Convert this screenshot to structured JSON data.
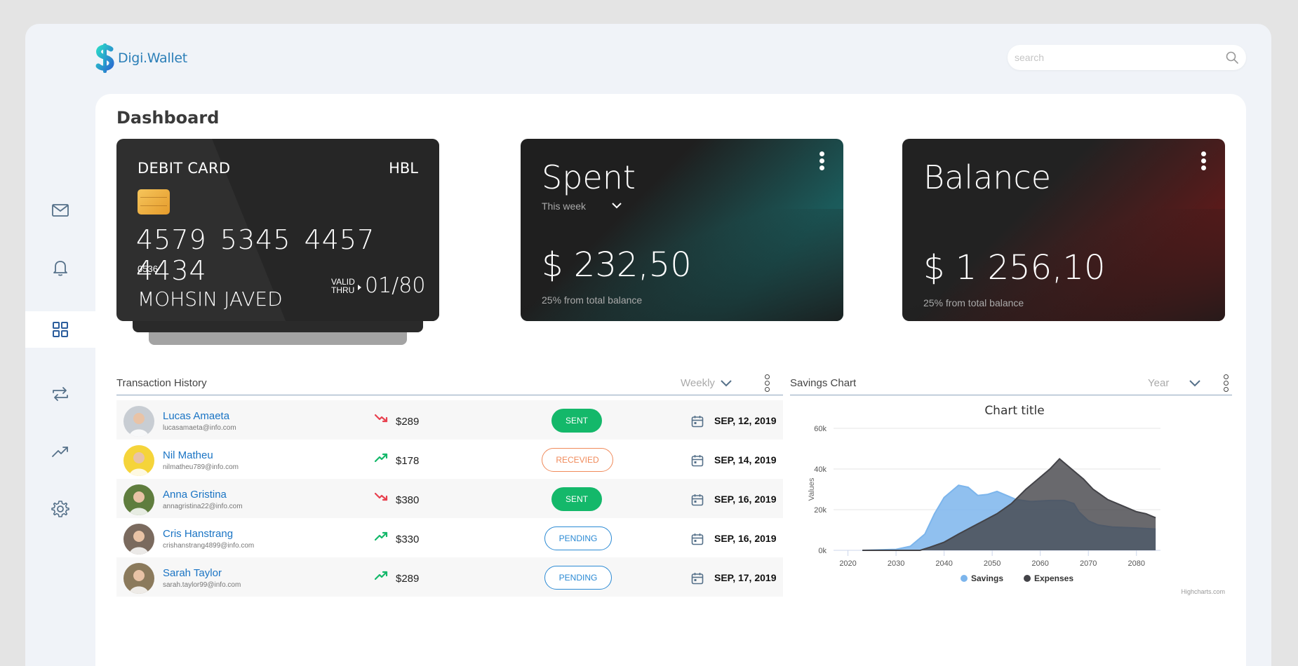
{
  "app": {
    "name": "Digi.Wallet"
  },
  "search": {
    "placeholder": "search"
  },
  "sidebar": {
    "items": [
      {
        "icon": "mail-icon",
        "active": false
      },
      {
        "icon": "bell-icon",
        "active": false
      },
      {
        "icon": "grid-icon",
        "active": true
      },
      {
        "icon": "transfer-icon",
        "active": false
      },
      {
        "icon": "trend-icon",
        "active": false
      },
      {
        "icon": "gear-icon",
        "active": false
      }
    ]
  },
  "page": {
    "title": "Dashboard"
  },
  "debit_card": {
    "label": "DEBIT CARD",
    "bank": "HBL",
    "number": "4579 5345 4457 4434",
    "code": "0536",
    "holder": "MOHSIN JAVED",
    "valid_label_1": "VALID",
    "valid_label_2": "THRU",
    "expiry": "01/80"
  },
  "spent": {
    "title": "Spent",
    "period": "This week",
    "amount": "$ 232,50",
    "note": "25% from total balance"
  },
  "balance": {
    "title": "Balance",
    "amount": "$ 1 256,10",
    "note": "25% from total balance"
  },
  "transactions": {
    "title": "Transaction History",
    "filter": "Weekly",
    "rows": [
      {
        "name": "Lucas Amaeta",
        "email": "lucasamaeta@info.com",
        "trend": "down",
        "amount": "$289",
        "status": "SENT",
        "status_type": "sent",
        "date": "SEP, 12, 2019",
        "avatar_color": "#c8cdd3"
      },
      {
        "name": "Nil Matheu",
        "email": "nilmatheu789@info.com",
        "trend": "up",
        "amount": "$178",
        "status": "RECEVIED",
        "status_type": "received",
        "date": "SEP, 14, 2019",
        "avatar_color": "#f5d43a"
      },
      {
        "name": "Anna Gristina",
        "email": "annagristina22@info.com",
        "trend": "down",
        "amount": "$380",
        "status": "SENT",
        "status_type": "sent",
        "date": "SEP, 16, 2019",
        "avatar_color": "#5f7d3e"
      },
      {
        "name": "Cris Hanstrang",
        "email": "crishanstrang4899@info.com",
        "trend": "up",
        "amount": "$330",
        "status": "PENDING",
        "status_type": "pending",
        "date": "SEP, 16, 2019",
        "avatar_color": "#7a6a5e"
      },
      {
        "name": "Sarah Taylor",
        "email": "sarah.taylor99@info.com",
        "trend": "up",
        "amount": "$289",
        "status": "PENDING",
        "status_type": "pending",
        "date": "SEP, 17, 2019",
        "avatar_color": "#8b7a5c"
      }
    ]
  },
  "savings": {
    "title": "Savings Chart",
    "filter": "Year",
    "credit": "Highcharts.com"
  },
  "chart_data": {
    "type": "area",
    "title": "Chart title",
    "ylabel": "Values",
    "xlabel": "",
    "xlim": [
      2017,
      2085
    ],
    "ylim": [
      0,
      60000
    ],
    "x_ticks": [
      2020,
      2030,
      2040,
      2050,
      2060,
      2070,
      2080
    ],
    "y_ticks": [
      "0k",
      "20k",
      "40k",
      "60k"
    ],
    "grid": true,
    "legend": "bottom-center",
    "series": [
      {
        "name": "Savings",
        "color": "#7cb5ec",
        "points": [
          [
            2023,
            0
          ],
          [
            2030,
            500
          ],
          [
            2033,
            2000
          ],
          [
            2036,
            8000
          ],
          [
            2038,
            18000
          ],
          [
            2040,
            26000
          ],
          [
            2043,
            32000
          ],
          [
            2045,
            31000
          ],
          [
            2047,
            27000
          ],
          [
            2049,
            27500
          ],
          [
            2051,
            29000
          ],
          [
            2053,
            27000
          ],
          [
            2055,
            25000
          ],
          [
            2058,
            24000
          ],
          [
            2062,
            24500
          ],
          [
            2065,
            24500
          ],
          [
            2067,
            23000
          ],
          [
            2068,
            19000
          ],
          [
            2070,
            14500
          ],
          [
            2072,
            12500
          ],
          [
            2075,
            11500
          ],
          [
            2080,
            11000
          ],
          [
            2084,
            10500
          ]
        ]
      },
      {
        "name": "Expenses",
        "color": "#434348",
        "points": [
          [
            2023,
            0
          ],
          [
            2035,
            0
          ],
          [
            2037,
            1500
          ],
          [
            2040,
            4000
          ],
          [
            2043,
            8000
          ],
          [
            2047,
            13000
          ],
          [
            2051,
            18000
          ],
          [
            2054,
            23000
          ],
          [
            2057,
            30000
          ],
          [
            2060,
            36000
          ],
          [
            2062,
            40000
          ],
          [
            2064,
            45000
          ],
          [
            2066,
            41000
          ],
          [
            2069,
            35000
          ],
          [
            2071,
            30000
          ],
          [
            2074,
            25000
          ],
          [
            2077,
            22000
          ],
          [
            2080,
            19000
          ],
          [
            2082,
            18000
          ],
          [
            2084,
            16000
          ]
        ]
      }
    ]
  }
}
